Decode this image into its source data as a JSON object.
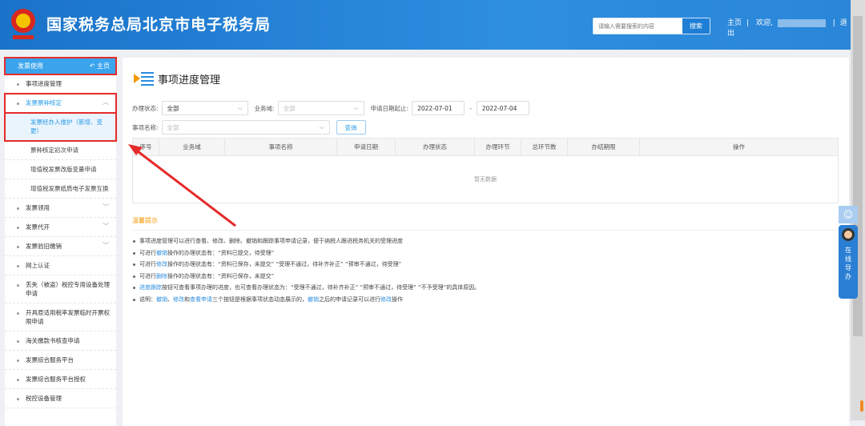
{
  "header": {
    "title": "国家税务总局北京市电子税务局",
    "search_placeholder": "请输入需要搜索的内容",
    "search_button": "搜索",
    "home": "主页",
    "welcome": "欢迎,",
    "logout": "退出"
  },
  "sidebar": {
    "section": "发票使用",
    "home": "主页",
    "items": [
      {
        "label": "事项进度管理"
      },
      {
        "label": "发票票种核定"
      },
      {
        "label": "发票经办人维护（新增、变更）"
      },
      {
        "label": "票种核定初次申请"
      },
      {
        "label": "增值税发票改版变量申请"
      },
      {
        "label": "增值税发票纸质电子发票互换"
      },
      {
        "label": "发票领用"
      },
      {
        "label": "发票代开"
      },
      {
        "label": "发票验旧缴销"
      },
      {
        "label": "网上认证"
      },
      {
        "label": "丢失（被盗）税控专用设备处理申请"
      },
      {
        "label": "开具原适用税率发票临时开票权限申请"
      },
      {
        "label": "海关缴款书核查申请"
      },
      {
        "label": "发票综合服务平台"
      },
      {
        "label": "发票综合服务平台授权"
      },
      {
        "label": "税控设备管理"
      }
    ]
  },
  "main": {
    "title": "事项进度管理",
    "filters": {
      "status_label": "办理状态:",
      "status_value": "全部",
      "domain_label": "业务域:",
      "domain_value": "全部",
      "date_label": "申请日期起止:",
      "date_from": "2022-07-01",
      "date_sep": "-",
      "date_to": "2022-07-04",
      "name_label": "事项名称:",
      "name_value": "全部",
      "query": "查询"
    },
    "table": {
      "columns": [
        "序号",
        "业务域",
        "事项名称",
        "申请日期",
        "办理状态",
        "办理环节",
        "总环节数",
        "办结期限",
        "操作"
      ],
      "empty": "暂无数据"
    },
    "tips": {
      "title": "温馨提示",
      "lines": [
        [
          "事项进度管理可以进行查看、修改、删除、撤销和跟踪事项申请记录，便于纳税人跟进税务机关的受理进度"
        ],
        [
          "可进行",
          "撤销",
          "操作的办理状态有：“资料已提交，待受理”"
        ],
        [
          "可进行",
          "修改",
          "操作的办理状态有：“资料已保存，未提交”  “受理不通过，待补齐补正”  “预审不通过，待受理”"
        ],
        [
          "可进行",
          "删除",
          "操作的办理状态有：“资料已保存，未提交”"
        ],
        [
          "",
          "进度跟踪",
          "按钮可查看事项办理的进度，也可查看办理状态为：“受理不通过，待补齐补正”  “预审不通过，待受理”  “不予受理”的具体原因。"
        ],
        [
          "说明：",
          "撤销",
          "、",
          "修改",
          "和",
          "查看申请",
          "三个按钮是根据事项状态动态展示的，",
          "撤销",
          "之后的申请记录可以进行",
          "修改",
          "操作"
        ]
      ]
    }
  },
  "float": {
    "guide": [
      "在",
      "线",
      "导",
      "办"
    ]
  },
  "colors": {
    "accent": "#2a9be6",
    "header": "#1f7fd6",
    "tip": "#f39800",
    "highlight": "#e52b2b"
  }
}
